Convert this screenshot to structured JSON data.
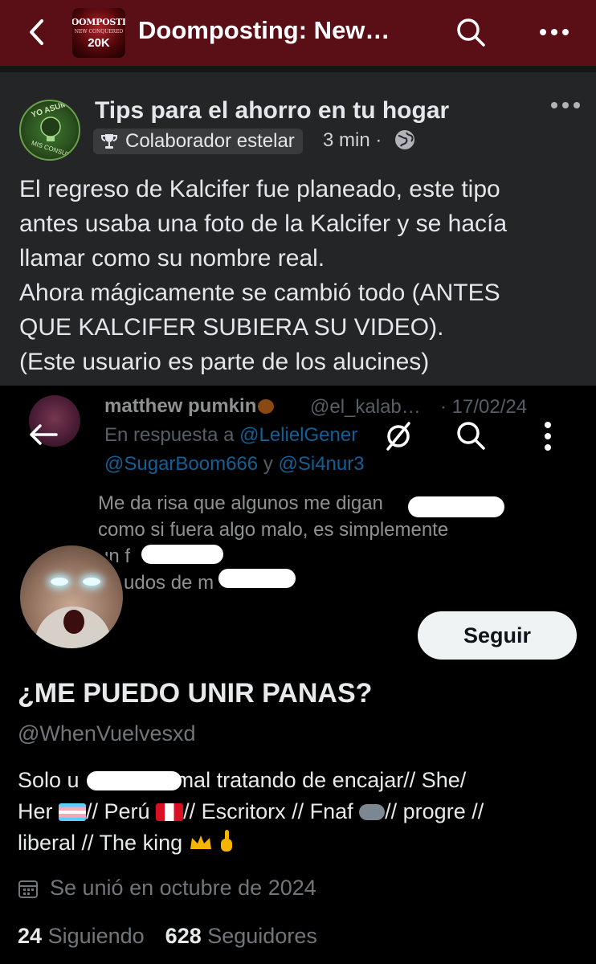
{
  "group_header": {
    "title": "Doomposting: New…",
    "logo_text": [
      "DOOMPOSTIN",
      "NEW CONQUERED",
      "20K"
    ]
  },
  "post": {
    "author": "Tips para el ahorro en tu hogar",
    "avatar_text": [
      "YO ASUMO",
      "MIS CONSUMO"
    ],
    "badge": "Colaborador estelar",
    "time": "3 min ·",
    "body": [
      "El regreso de Kalcifer fue planeado, este tipo",
      "antes usaba una foto de la Kalcifer y se hacía",
      "llamar como su nombre real.",
      "Ahora mágicamente se cambió todo (ANTES",
      "QUE KALCIFER SUBIERA SU VIDEO).",
      "(Este usuario es parte de los alucines)"
    ]
  },
  "screenshot_tweet": {
    "name": "matthew pumkin",
    "handle": "@el_kalab…",
    "date": "· 17/02/24",
    "reply_prefix": "En respuesta a",
    "reply_to": "@LelielGener",
    "mentions_a": "@SugarBoom666",
    "mentions_join": "y",
    "mentions_b": "@Si4nur3",
    "text": [
      "Me da risa que algunos me digan",
      "como si fuera algo malo, es simplemente",
      "un f",
      "udos de m"
    ]
  },
  "profile": {
    "follow_label": "Seguir",
    "display_name": "¿ME PUEDO UNIR PANAS?",
    "handle": "@WhenVuelvesxd",
    "bio_line1_a": "Solo u",
    "bio_line1_b": "ormal tratando de encajar// She/",
    "bio_line2_a": "Her",
    "bio_line2_b": "// Perú",
    "bio_line2_c": "// Escritorx // Fnaf",
    "bio_line2_d": "// progre //",
    "bio_line3": "liberal // The king",
    "joined": "Se unió en octubre de 2024",
    "following_count": "24",
    "following_label": "Siguiendo",
    "followers_count": "628",
    "followers_label": "Seguidores"
  },
  "colors": {
    "group_header_bg": "#5a0f16",
    "post_bg": "#242526",
    "twitter_bg": "#000000",
    "link_blue": "#1d9bf0"
  }
}
